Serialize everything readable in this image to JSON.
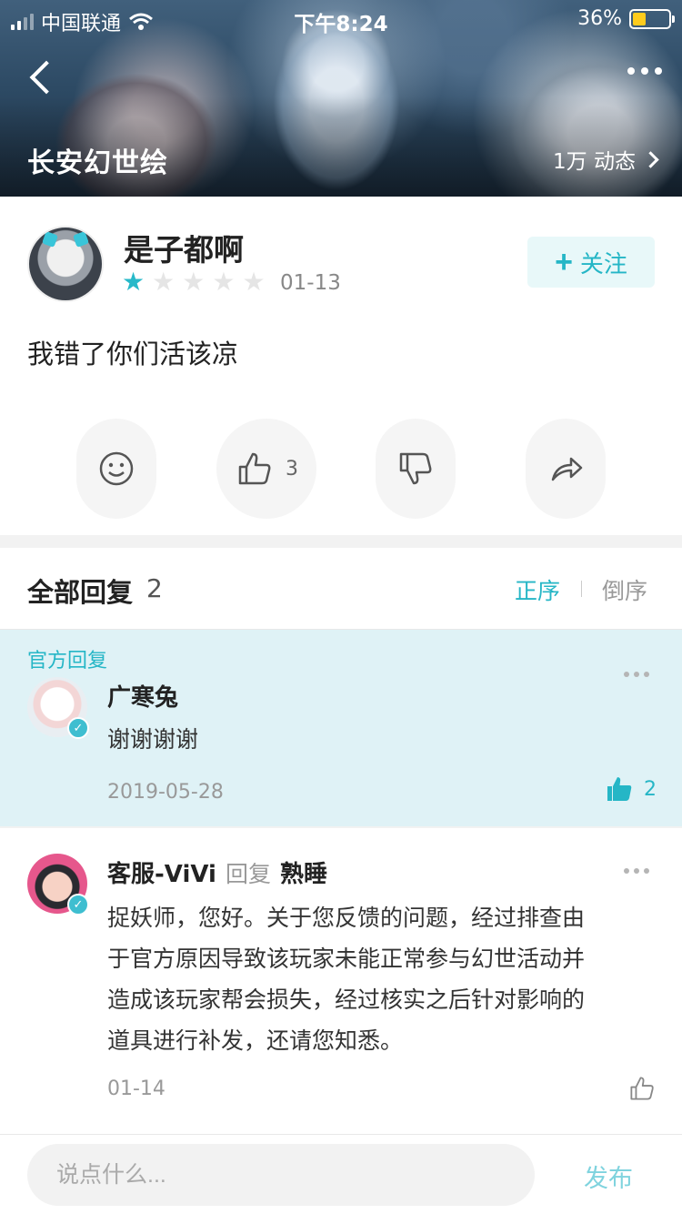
{
  "status_bar": {
    "carrier": "中国联通",
    "time": "下午8:24",
    "battery": "36%",
    "battery_level": 0.36
  },
  "header": {
    "game_title": "长安幻世绘",
    "dynamics": "1万 动态",
    "logo_text": "长安幻世绘"
  },
  "post": {
    "username": "是子都啊",
    "rating": 1,
    "rating_max": 5,
    "date": "01-13",
    "follow_label": "+ 关注",
    "follow_text": "关注",
    "content": "我错了你们活该凉",
    "actions": {
      "like_count": "3"
    }
  },
  "replies_header": {
    "title": "全部回复",
    "count": "2",
    "sort_asc": "正序",
    "sort_desc": "倒序"
  },
  "replies": [
    {
      "official_label": "官方回复",
      "name": "广寒兔",
      "text": "谢谢谢谢",
      "date": "2019-05-28",
      "likes": "2",
      "liked": true
    },
    {
      "name": "客服-ViVi",
      "reply_word": "回复",
      "reply_to": "熟睡",
      "text_lines": [
        "捉妖师，您好。关于您反馈的问题，经过排查由",
        "于官方原因导致该玩家未能正常参与幻世活动并",
        "造成该玩家帮会损失，经过核实之后针对影响的",
        "道具进行补发，还请您知悉。"
      ],
      "date": "01-14",
      "liked": false
    }
  ],
  "bottom": {
    "placeholder": "说点什么...",
    "publish": "发布"
  },
  "colors": {
    "accent": "#25b6c6",
    "official_bg": "#dff2f6",
    "battery": "#ffcc1d"
  }
}
